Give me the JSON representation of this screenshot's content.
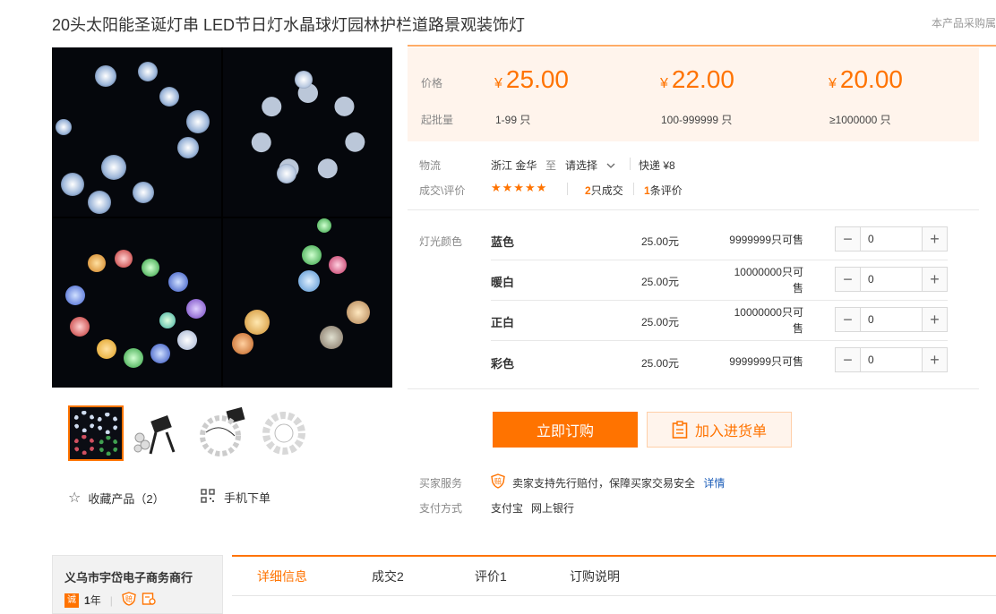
{
  "product": {
    "title": "20头太阳能圣诞灯串 LED节日灯水晶球灯园林护栏道路景观装饰灯",
    "top_right_text": "本产品采购属"
  },
  "gallery": {
    "thumbnails": [
      "thumb-1",
      "thumb-2",
      "thumb-3",
      "thumb-4"
    ],
    "favorite_label": "收藏产品（2）",
    "mobile_order_label": "手机下单"
  },
  "pricing": {
    "price_label": "价格",
    "moq_label": "起批量",
    "currency": "¥",
    "tiers": [
      {
        "price": "25.00",
        "moq": "1-99 只"
      },
      {
        "price": "22.00",
        "moq": "100-999999 只"
      },
      {
        "price": "20.00",
        "moq": "≥1000000 只"
      }
    ]
  },
  "logistics": {
    "label": "物流",
    "from": "浙江 金华",
    "to_word": "至",
    "destination": "请选择",
    "shipping": "快递 ¥8"
  },
  "deals": {
    "label": "成交\\评价",
    "stars": "★★★★★",
    "deal_count": "2",
    "deal_suffix": "只成交",
    "review_count": "1",
    "review_suffix": "条评价"
  },
  "sku": {
    "label": "灯光颜色",
    "items": [
      {
        "name": "蓝色",
        "price": "25.00元",
        "stock_line1": "9999999只可售",
        "stock_line2": "",
        "qty": "0"
      },
      {
        "name": "暖白",
        "price": "25.00元",
        "stock_line1": "10000000只可",
        "stock_line2": "售",
        "qty": "0"
      },
      {
        "name": "正白",
        "price": "25.00元",
        "stock_line1": "10000000只可",
        "stock_line2": "售",
        "qty": "0"
      },
      {
        "name": "彩色",
        "price": "25.00元",
        "stock_line1": "9999999只可售",
        "stock_line2": "",
        "qty": "0"
      }
    ]
  },
  "actions": {
    "buy_now": "立即订购",
    "add_to_cart": "加入进货单"
  },
  "service": {
    "label": "买家服务",
    "text": "卖家支持先行赔付，保障买家交易安全",
    "detail_link": "详情"
  },
  "payment": {
    "label": "支付方式",
    "methods": [
      "支付宝",
      "网上银行"
    ]
  },
  "shop": {
    "name": "义乌市宇岱电子商务商行",
    "years": "1",
    "years_suffix": "年"
  },
  "tabs": [
    "详细信息",
    "成交2",
    "评价1",
    "订购说明"
  ],
  "colors": {
    "accent": "#ff7300",
    "price_bg": "#fff4ec",
    "link": "#1a5cb8"
  }
}
